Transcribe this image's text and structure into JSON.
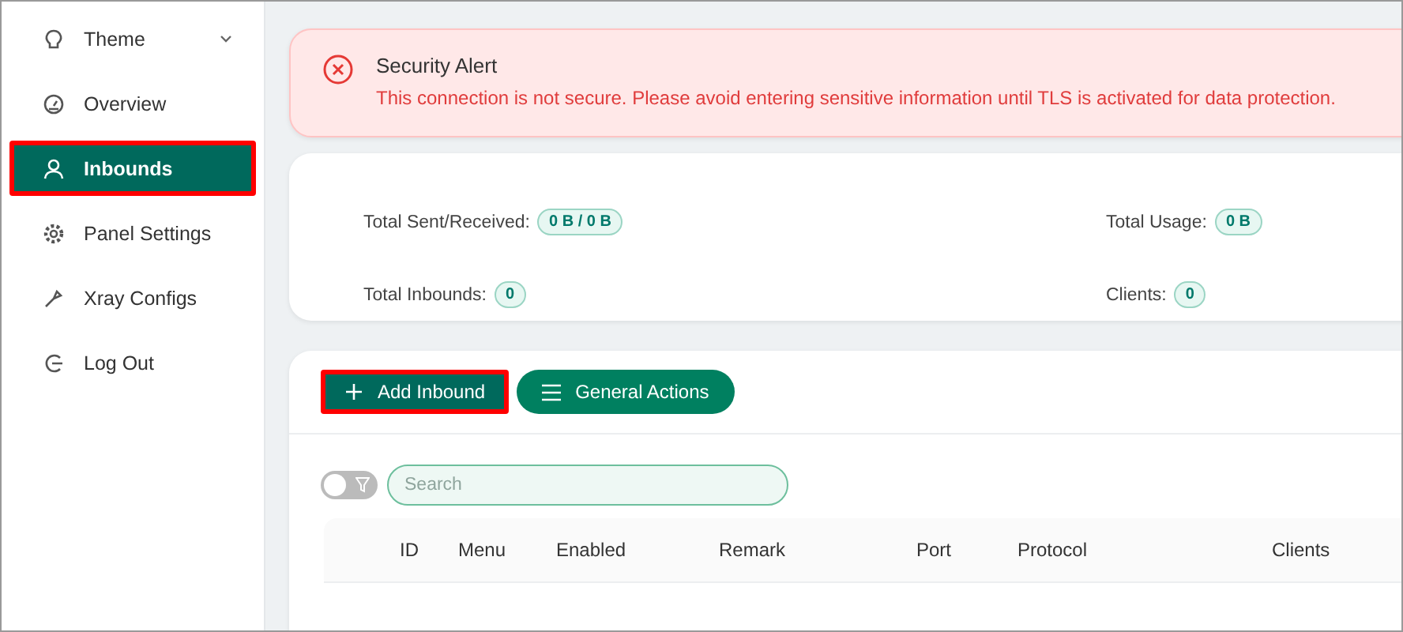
{
  "sidebar": {
    "items": [
      {
        "label": "Theme",
        "expandable": true,
        "selected": false,
        "highlighted": false
      },
      {
        "label": "Overview",
        "expandable": false,
        "selected": false,
        "highlighted": false
      },
      {
        "label": "Inbounds",
        "expandable": false,
        "selected": true,
        "highlighted": true
      },
      {
        "label": "Panel Settings",
        "expandable": false,
        "selected": false,
        "highlighted": false
      },
      {
        "label": "Xray Configs",
        "expandable": false,
        "selected": false,
        "highlighted": false
      },
      {
        "label": "Log Out",
        "expandable": false,
        "selected": false,
        "highlighted": false
      }
    ]
  },
  "alert": {
    "title": "Security Alert",
    "message": "This connection is not secure. Please avoid entering sensitive information until TLS is activated for data protection."
  },
  "stats": [
    {
      "label": "Total Sent/Received:",
      "value": "0 B / 0 B"
    },
    {
      "label": "Total Usage:",
      "value": "0 B"
    },
    {
      "label": "Total Inbounds:",
      "value": "0"
    },
    {
      "label": "Clients:",
      "value": "0"
    }
  ],
  "actions": [
    {
      "label": "Add Inbound",
      "highlighted": true
    },
    {
      "label": "General Actions",
      "highlighted": false
    }
  ],
  "filter_toggle": {
    "on": false
  },
  "search": {
    "placeholder": "Search"
  },
  "table": {
    "columns": [
      "ID",
      "Menu",
      "Enabled",
      "Remark",
      "Port",
      "Protocol",
      "Clients"
    ]
  }
}
